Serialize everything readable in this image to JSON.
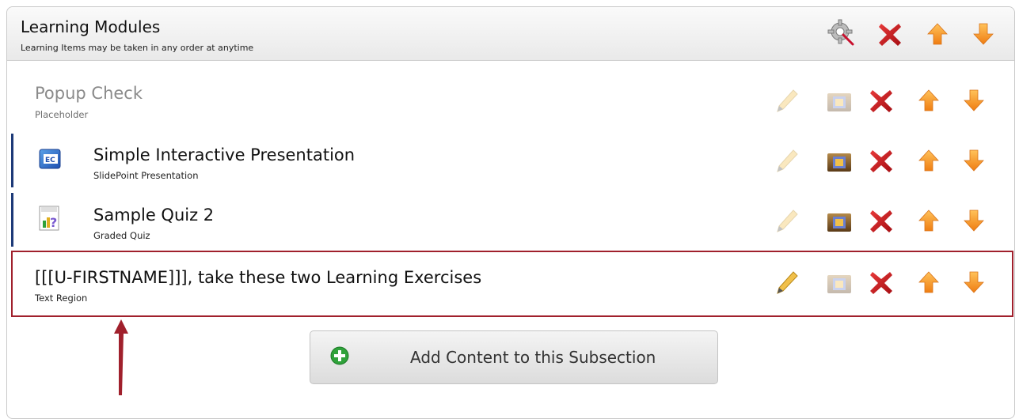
{
  "header": {
    "title": "Learning Modules",
    "subtitle": "Learning Items may be taken in any order at anytime",
    "icons": [
      "settings-gear-icon",
      "delete-x-icon",
      "move-up-arrow-icon",
      "move-down-arrow-icon"
    ]
  },
  "rows": [
    {
      "title": "Popup Check",
      "subtitle": "Placeholder",
      "type_icon": null,
      "state": "disabled"
    },
    {
      "title": "Simple Interactive Presentation",
      "subtitle": "SlidePoint Presentation",
      "type_icon": "presentation-icon",
      "state": "normal"
    },
    {
      "title": "Sample Quiz 2",
      "subtitle": "Graded Quiz",
      "type_icon": "graded-quiz-icon",
      "state": "normal"
    },
    {
      "title": "[[[U-FIRSTNAME]]], take these two Learning Exercises",
      "subtitle": "Text Region",
      "type_icon": null,
      "state": "highlighted"
    }
  ],
  "row_actions": [
    "edit-pencil-icon",
    "folder-icon",
    "delete-x-icon",
    "move-up-arrow-icon",
    "move-down-arrow-icon"
  ],
  "add_button": {
    "label": "Add Content to this Subsection",
    "icon": "plus-circle-icon"
  },
  "colors": {
    "highlight_border": "#a0202c",
    "arrow": "#a0202c",
    "accent_orange": "#f5921e",
    "delete_red": "#c8102e",
    "row_bar": "#1d3a78",
    "plus_green": "#2fa23a"
  }
}
